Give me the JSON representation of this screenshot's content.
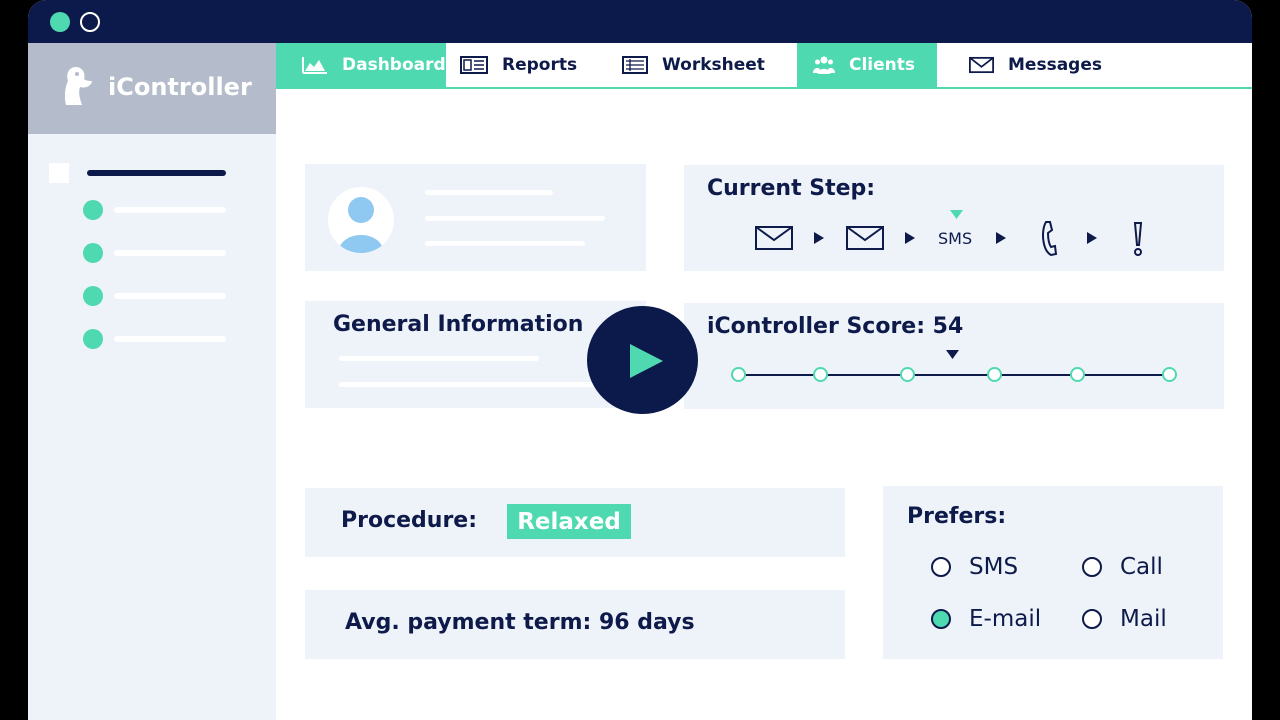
{
  "app": {
    "name": "iController"
  },
  "tabs": [
    {
      "label": "Dashboard",
      "icon": "chart-area-icon",
      "active": true
    },
    {
      "label": "Reports",
      "icon": "report-icon",
      "active": false
    },
    {
      "label": "Worksheet",
      "icon": "worksheet-icon",
      "active": false
    },
    {
      "label": "Clients",
      "icon": "users-icon",
      "active": true
    },
    {
      "label": "Messages",
      "icon": "envelope-icon",
      "active": false
    }
  ],
  "current_step": {
    "title": "Current Step:",
    "steps": [
      "email",
      "email",
      "SMS",
      "phone",
      "alert"
    ],
    "sms_label": "SMS",
    "active_step": "SMS"
  },
  "general": {
    "title": "General Information"
  },
  "score": {
    "title": "iController Score: 54",
    "value": 54
  },
  "procedure": {
    "label": "Procedure:",
    "value": "Relaxed"
  },
  "payment": {
    "text": "Avg. payment term:  96 days"
  },
  "prefers": {
    "title": "Prefers:",
    "options": [
      {
        "label": "SMS",
        "selected": false
      },
      {
        "label": "Call",
        "selected": false
      },
      {
        "label": "E-mail",
        "selected": true
      },
      {
        "label": "Mail",
        "selected": false
      }
    ]
  },
  "colors": {
    "accent": "#4fd9b0",
    "navy": "#0c1a4b",
    "panel": "#eef3f9",
    "brand_bg": "#b4bccb"
  }
}
